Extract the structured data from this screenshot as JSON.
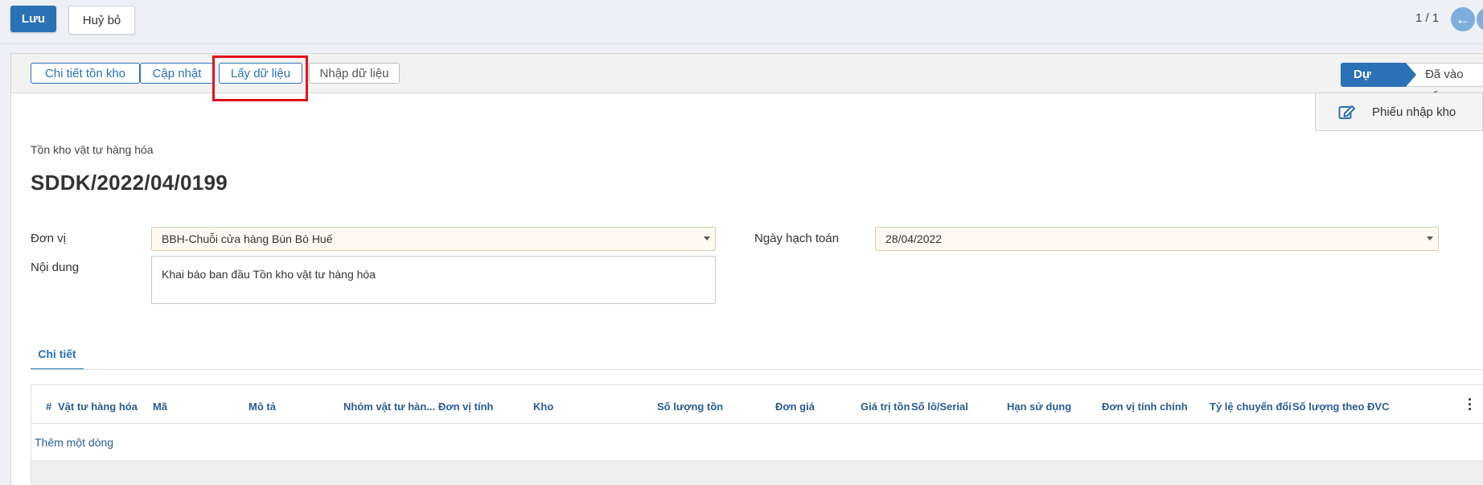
{
  "toolbar": {
    "save_label": "Lưu",
    "cancel_label": "Huỷ bỏ",
    "pager": "1 / 1"
  },
  "statusbar": {
    "buttons": [
      "Chi tiết tồn kho",
      "Cập nhật",
      "Lấy dữ liệu",
      "Nhập dữ liệu"
    ],
    "stages": {
      "active": "Dự thảo",
      "next": "Đã vào sổ"
    }
  },
  "smart_button": {
    "label": "Phiếu nhập kho",
    "icon": "edit-icon"
  },
  "document": {
    "type": "Tồn kho vật tư hàng hóa",
    "name": "SDDK/2022/04/0199"
  },
  "fields": {
    "don_vi": {
      "label": "Đơn vị",
      "value": "BBH-Chuỗi cửa hàng Bún Bò Huế"
    },
    "noi_dung": {
      "label": "Nội dung",
      "value": "Khai báo ban đầu Tồn kho vật tư hàng hóa"
    },
    "ngay_hach_toan": {
      "label": "Ngày hạch toán",
      "value": "28/04/2022"
    }
  },
  "tabs": {
    "detail": "Chi tiết"
  },
  "table": {
    "columns": [
      "#",
      "Vật tư hàng hóa",
      "Mã",
      "Mô tả",
      "Nhóm vật tư hàn...",
      "Đơn vị tính",
      "Kho",
      "Số lượng tồn",
      "Đơn giá",
      "Giá trị tồn",
      "Số lô/Serial",
      "Hạn sử dụng",
      "Đơn vị tính chính",
      "Tỷ lệ chuyển đổi",
      "Số lượng theo ĐVC"
    ],
    "add_row": "Thêm một dòng"
  },
  "colors": {
    "primary": "#2a72b5",
    "highlight_box": "#e3101a",
    "required_field_bg": "#fffaf1"
  }
}
